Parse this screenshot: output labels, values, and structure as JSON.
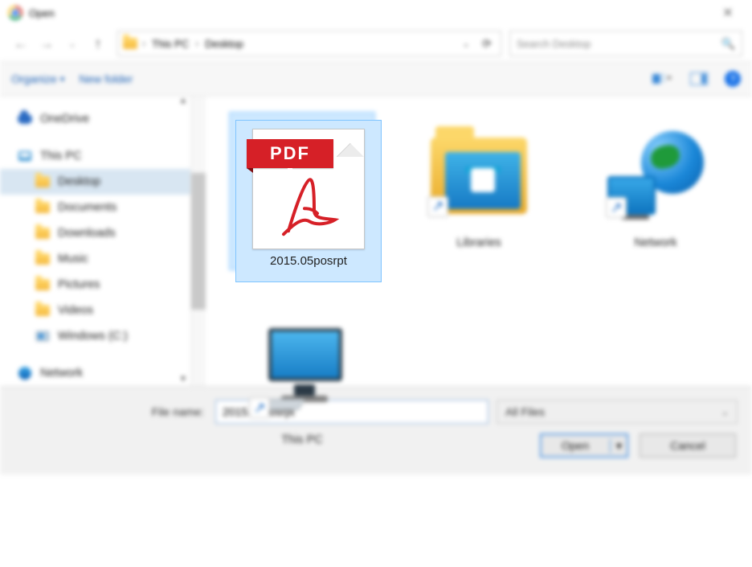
{
  "titlebar": {
    "title": "Open"
  },
  "nav": {
    "breadcrumb": [
      "This PC",
      "Desktop"
    ],
    "search_placeholder": "Search Desktop"
  },
  "toolbar": {
    "organize": "Organize",
    "new_folder": "New folder"
  },
  "sidebar": {
    "groups": [
      {
        "items": [
          {
            "label": "OneDrive",
            "icon": "onedrive"
          }
        ]
      },
      {
        "items": [
          {
            "label": "This PC",
            "icon": "pc"
          },
          {
            "label": "Desktop",
            "icon": "folder",
            "selected": true,
            "indent": true
          },
          {
            "label": "Documents",
            "icon": "folder",
            "indent": true
          },
          {
            "label": "Downloads",
            "icon": "folder",
            "indent": true
          },
          {
            "label": "Music",
            "icon": "folder",
            "indent": true
          },
          {
            "label": "Pictures",
            "icon": "folder",
            "indent": true
          },
          {
            "label": "Videos",
            "icon": "folder",
            "indent": true
          },
          {
            "label": "Windows (C:)",
            "icon": "disk",
            "indent": true
          }
        ]
      },
      {
        "items": [
          {
            "label": "Network",
            "icon": "network"
          }
        ]
      }
    ]
  },
  "files": {
    "items": [
      {
        "label": "2015.05posrpt",
        "type": "pdf",
        "selected": true
      },
      {
        "label": "Libraries",
        "type": "libraries-shortcut"
      },
      {
        "label": "Network",
        "type": "network-shortcut"
      },
      {
        "label": "This PC",
        "type": "thispc-shortcut"
      }
    ]
  },
  "bottom": {
    "filename_label": "File name:",
    "filename_value": "2015.05posrpt",
    "filetype": "All Files",
    "open": "Open",
    "cancel": "Cancel"
  }
}
